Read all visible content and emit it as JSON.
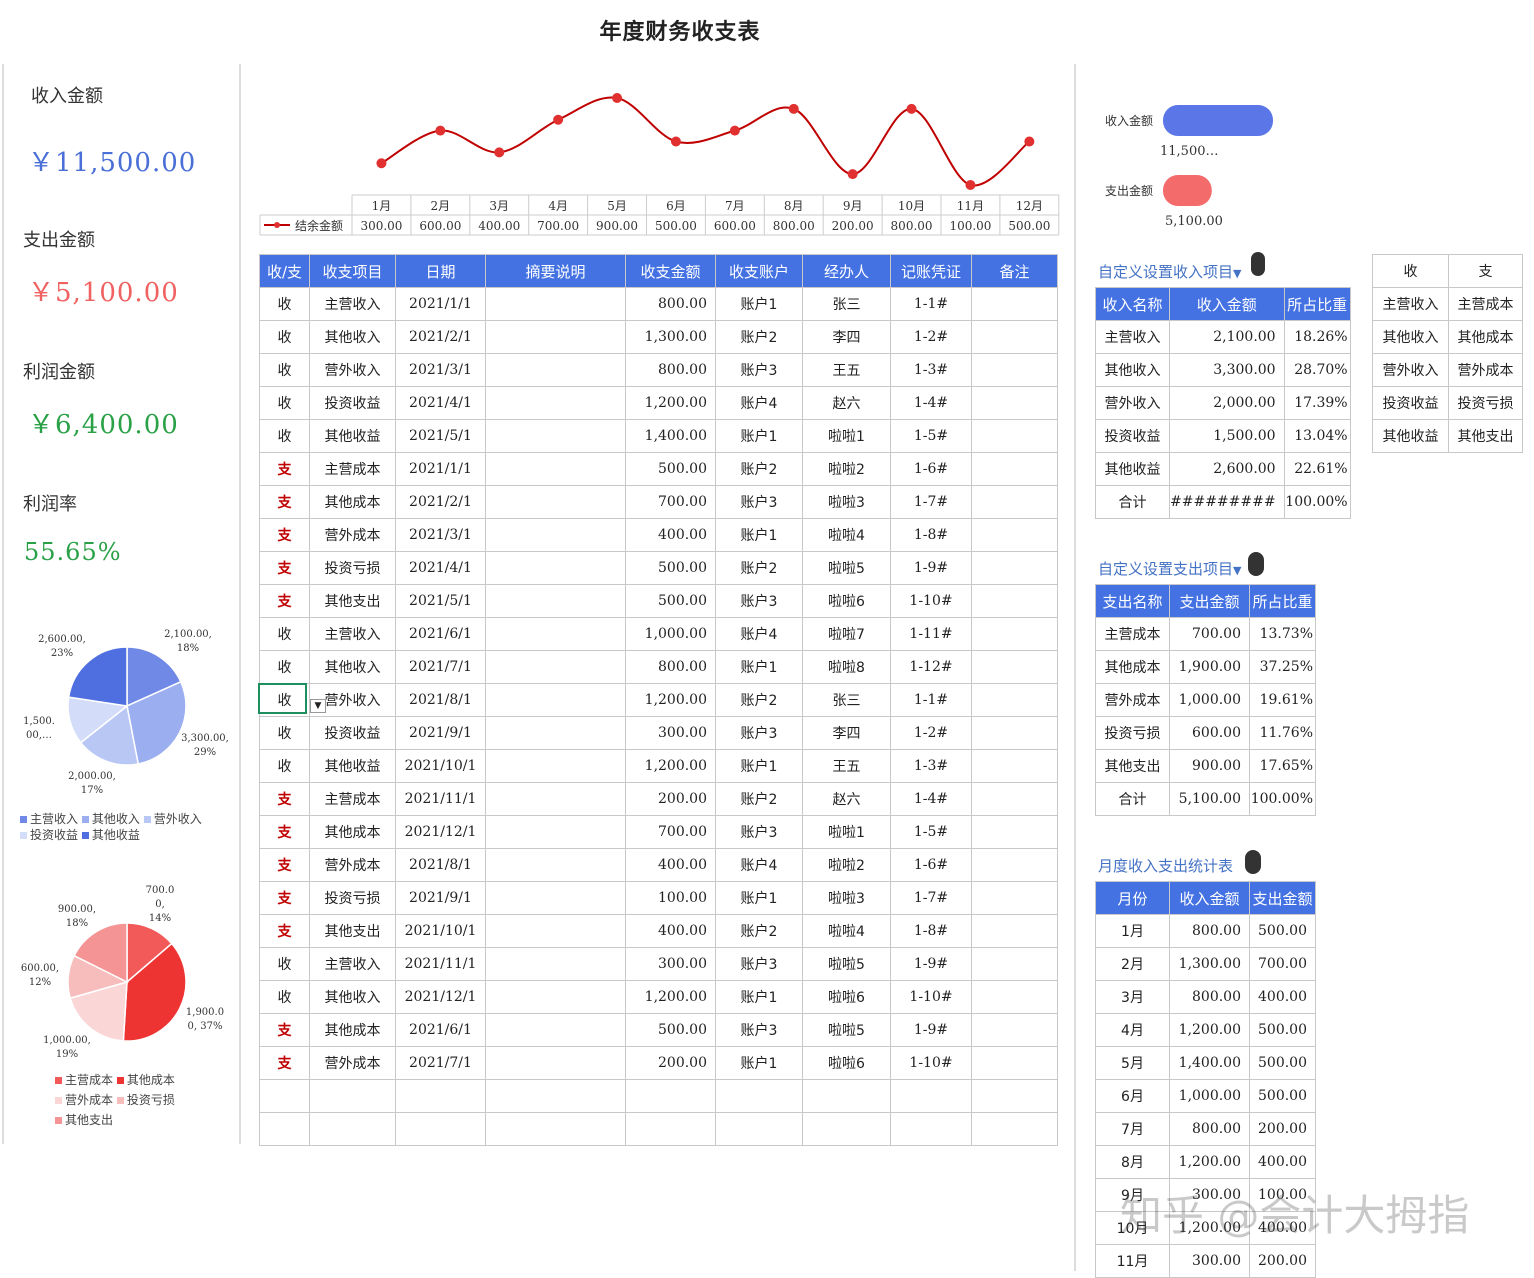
{
  "title": "年度财务收支表",
  "kpis": [
    {
      "label": "收入金额",
      "value": "￥11,500.00",
      "color": "#4a6fd6"
    },
    {
      "label": "支出金额",
      "value": "￥5,100.00",
      "color": "#f06262"
    },
    {
      "label": "利润金额",
      "value": "￥6,400.00",
      "color": "#2aa147"
    },
    {
      "label": "利润率",
      "value": "55.65%",
      "color": "#2aa147"
    }
  ],
  "pie_income": {
    "slices": [
      {
        "name": "主营收入",
        "value": 2100,
        "label_a": "2,100.00,",
        "label_b": "18%",
        "color": "#7089e6"
      },
      {
        "name": "其他收入",
        "value": 3300,
        "label_a": "3,300.00,",
        "label_b": "29%",
        "color": "#9aaef0"
      },
      {
        "name": "营外收入",
        "value": 2000,
        "label_a": "2,000.00,",
        "label_b": "17%",
        "color": "#b9c7f5"
      },
      {
        "name": "投资收益",
        "value": 1500,
        "label_a": "1,500.",
        "label_b": "00,…",
        "color": "#d3dcf9"
      },
      {
        "name": "其他收益",
        "value": 2600,
        "label_a": "2,600.00,",
        "label_b": "23%",
        "color": "#4f6ee0"
      }
    ]
  },
  "pie_expense": {
    "slices": [
      {
        "name": "主营成本",
        "value": 700,
        "label_a": "700.0",
        "label_b": "0,",
        "label_c": "14%",
        "color": "#f25a5a"
      },
      {
        "name": "其他成本",
        "value": 1900,
        "label_a": "1,900.0",
        "label_b": "0, 37%",
        "color": "#ee3333"
      },
      {
        "name": "营外成本",
        "value": 1000,
        "label_a": "1,000.00,",
        "label_b": "19%",
        "color": "#fad6d6"
      },
      {
        "name": "投资亏损",
        "value": 600,
        "label_a": "600.00,",
        "label_b": "12%",
        "color": "#f7bcbc"
      },
      {
        "name": "其他支出",
        "value": 900,
        "label_a": "900.00,",
        "label_b": "18%",
        "color": "#f49494"
      }
    ]
  },
  "chart_data": {
    "type": "line",
    "categories": [
      "1月",
      "2月",
      "3月",
      "4月",
      "5月",
      "6月",
      "7月",
      "8月",
      "9月",
      "10月",
      "11月",
      "12月"
    ],
    "series": [
      {
        "name": "结余金额",
        "values": [
          300,
          600,
          400,
          700,
          900,
          500,
          600,
          800,
          200,
          800,
          100,
          500
        ]
      }
    ],
    "value_labels": [
      "300.00",
      "600.00",
      "400.00",
      "700.00",
      "900.00",
      "500.00",
      "600.00",
      "800.00",
      "200.00",
      "800.00",
      "100.00",
      "500.00"
    ],
    "line_color": "#c00000",
    "marker_color": "#e03030"
  },
  "main_table": {
    "headers": [
      "收/支",
      "收支项目",
      "日期",
      "摘要说明",
      "收支金额",
      "收支账户",
      "经办人",
      "记账凭证",
      "备注"
    ],
    "rows": [
      [
        "收",
        "主营收入",
        "2021/1/1",
        "",
        "800.00",
        "账户1",
        "张三",
        "1-1#",
        ""
      ],
      [
        "收",
        "其他收入",
        "2021/2/1",
        "",
        "1,300.00",
        "账户2",
        "李四",
        "1-2#",
        ""
      ],
      [
        "收",
        "营外收入",
        "2021/3/1",
        "",
        "800.00",
        "账户3",
        "王五",
        "1-3#",
        ""
      ],
      [
        "收",
        "投资收益",
        "2021/4/1",
        "",
        "1,200.00",
        "账户4",
        "赵六",
        "1-4#",
        ""
      ],
      [
        "收",
        "其他收益",
        "2021/5/1",
        "",
        "1,400.00",
        "账户1",
        "啦啦1",
        "1-5#",
        ""
      ],
      [
        "支",
        "主营成本",
        "2021/1/1",
        "",
        "500.00",
        "账户2",
        "啦啦2",
        "1-6#",
        ""
      ],
      [
        "支",
        "其他成本",
        "2021/2/1",
        "",
        "700.00",
        "账户3",
        "啦啦3",
        "1-7#",
        ""
      ],
      [
        "支",
        "营外成本",
        "2021/3/1",
        "",
        "400.00",
        "账户1",
        "啦啦4",
        "1-8#",
        ""
      ],
      [
        "支",
        "投资亏损",
        "2021/4/1",
        "",
        "500.00",
        "账户2",
        "啦啦5",
        "1-9#",
        ""
      ],
      [
        "支",
        "其他支出",
        "2021/5/1",
        "",
        "500.00",
        "账户3",
        "啦啦6",
        "1-10#",
        ""
      ],
      [
        "收",
        "主营收入",
        "2021/6/1",
        "",
        "1,000.00",
        "账户4",
        "啦啦7",
        "1-11#",
        ""
      ],
      [
        "收",
        "其他收入",
        "2021/7/1",
        "",
        "800.00",
        "账户1",
        "啦啦8",
        "1-12#",
        ""
      ],
      [
        "收",
        "营外收入",
        "2021/8/1",
        "",
        "1,200.00",
        "账户2",
        "张三",
        "1-1#",
        ""
      ],
      [
        "收",
        "投资收益",
        "2021/9/1",
        "",
        "300.00",
        "账户3",
        "李四",
        "1-2#",
        ""
      ],
      [
        "收",
        "其他收益",
        "2021/10/1",
        "",
        "1,200.00",
        "账户1",
        "王五",
        "1-3#",
        ""
      ],
      [
        "支",
        "主营成本",
        "2021/11/1",
        "",
        "200.00",
        "账户2",
        "赵六",
        "1-4#",
        ""
      ],
      [
        "支",
        "其他成本",
        "2021/12/1",
        "",
        "700.00",
        "账户3",
        "啦啦1",
        "1-5#",
        ""
      ],
      [
        "支",
        "营外成本",
        "2021/8/1",
        "",
        "400.00",
        "账户4",
        "啦啦2",
        "1-6#",
        ""
      ],
      [
        "支",
        "投资亏损",
        "2021/9/1",
        "",
        "100.00",
        "账户1",
        "啦啦3",
        "1-7#",
        ""
      ],
      [
        "支",
        "其他支出",
        "2021/10/1",
        "",
        "400.00",
        "账户2",
        "啦啦4",
        "1-8#",
        ""
      ],
      [
        "收",
        "主营收入",
        "2021/11/1",
        "",
        "300.00",
        "账户3",
        "啦啦5",
        "1-9#",
        ""
      ],
      [
        "收",
        "其他收入",
        "2021/12/1",
        "",
        "1,200.00",
        "账户1",
        "啦啦6",
        "1-10#",
        ""
      ],
      [
        "支",
        "其他成本",
        "2021/6/1",
        "",
        "500.00",
        "账户3",
        "啦啦5",
        "1-9#",
        ""
      ],
      [
        "支",
        "营外成本",
        "2021/7/1",
        "",
        "200.00",
        "账户1",
        "啦啦6",
        "1-10#",
        ""
      ],
      [
        "",
        "",
        "",
        "",
        "",
        "",
        "",
        "",
        ""
      ],
      [
        "",
        "",
        "",
        "",
        "",
        "",
        "",
        "",
        ""
      ]
    ]
  },
  "bar_summary": {
    "items": [
      {
        "label": "收入金额",
        "value_text": "11,500…",
        "value": 11500,
        "color": "#5b76e6"
      },
      {
        "label": "支出金额",
        "value_text": "5,100.00",
        "value": 5100,
        "color": "#f46b6b"
      }
    ]
  },
  "income_setup": {
    "title": "自定义设置收入项目",
    "headers": [
      "收入名称",
      "收入金额",
      "所占比重"
    ],
    "rows": [
      [
        "主营收入",
        "2,100.00",
        "18.26%"
      ],
      [
        "其他收入",
        "3,300.00",
        "28.70%"
      ],
      [
        "营外收入",
        "2,000.00",
        "17.39%"
      ],
      [
        "投资收益",
        "1,500.00",
        "13.04%"
      ],
      [
        "其他收益",
        "2,600.00",
        "22.61%"
      ],
      [
        "合计",
        "#########",
        "100.00%"
      ]
    ]
  },
  "expense_setup": {
    "title": "自定义设置支出项目",
    "headers": [
      "支出名称",
      "支出金额",
      "所占比重"
    ],
    "rows": [
      [
        "主营成本",
        "700.00",
        "13.73%"
      ],
      [
        "其他成本",
        "1,900.00",
        "37.25%"
      ],
      [
        "营外成本",
        "1,000.00",
        "19.61%"
      ],
      [
        "投资亏损",
        "600.00",
        "11.76%"
      ],
      [
        "其他支出",
        "900.00",
        "17.65%"
      ],
      [
        "合计",
        "5,100.00",
        "100.00%"
      ]
    ]
  },
  "monthly": {
    "title": "月度收入支出统计表",
    "headers": [
      "月份",
      "收入金额",
      "支出金额"
    ],
    "rows": [
      [
        "1月",
        "800.00",
        "500.00"
      ],
      [
        "2月",
        "1,300.00",
        "700.00"
      ],
      [
        "3月",
        "800.00",
        "400.00"
      ],
      [
        "4月",
        "1,200.00",
        "500.00"
      ],
      [
        "5月",
        "1,400.00",
        "500.00"
      ],
      [
        "6月",
        "1,000.00",
        "500.00"
      ],
      [
        "7月",
        "800.00",
        "200.00"
      ],
      [
        "8月",
        "1,200.00",
        "400.00"
      ],
      [
        "9月",
        "300.00",
        "100.00"
      ],
      [
        "10月",
        "1,200.00",
        "400.00"
      ],
      [
        "11月",
        "300.00",
        "200.00"
      ]
    ]
  },
  "category_map": {
    "headers": [
      "收",
      "支"
    ],
    "rows": [
      [
        "主营收入",
        "主营成本"
      ],
      [
        "其他收入",
        "其他成本"
      ],
      [
        "营外收入",
        "营外成本"
      ],
      [
        "投资收益",
        "投资亏损"
      ],
      [
        "其他收益",
        "其他支出"
      ]
    ]
  },
  "watermark": "知乎 @会计大拇指",
  "icons": {
    "filter": "filter-dropdown-icon",
    "dropdown": "cell-dropdown-icon"
  }
}
